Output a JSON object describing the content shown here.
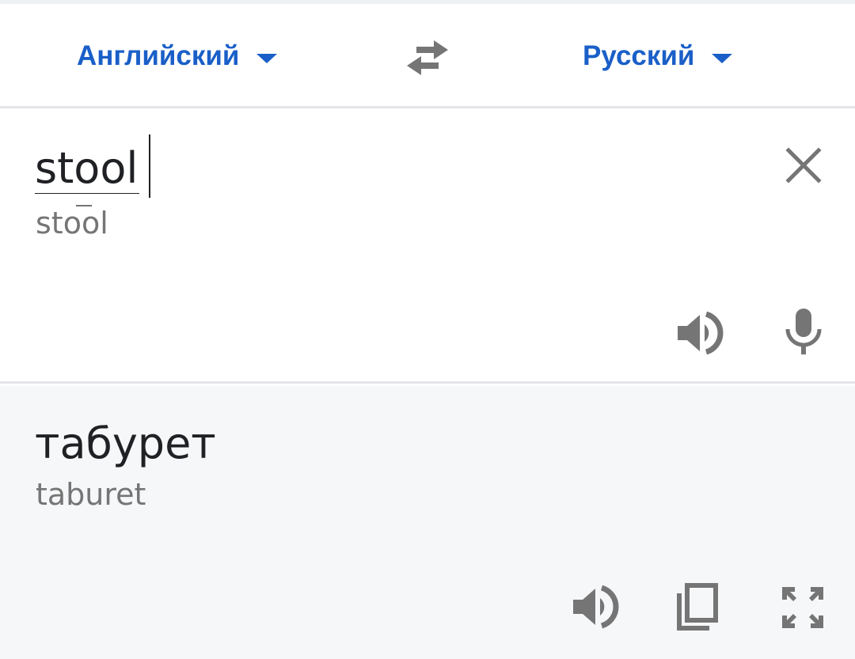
{
  "language_bar": {
    "source_language": "Английский",
    "target_language": "Русский",
    "swap_icon": "swap-arrows-icon"
  },
  "input": {
    "text": "stool",
    "transliteration": "stool",
    "clear_icon": "close-icon",
    "speak_icon": "speaker-icon",
    "mic_icon": "microphone-icon"
  },
  "output": {
    "text": "табурет",
    "transliteration": "taburet",
    "speak_icon": "speaker-icon",
    "copy_icon": "copy-icon",
    "fullscreen_icon": "fullscreen-icon"
  },
  "colors": {
    "accent": "#1a5fc8",
    "icon": "#757575",
    "output_background": "#f6f7f9"
  }
}
